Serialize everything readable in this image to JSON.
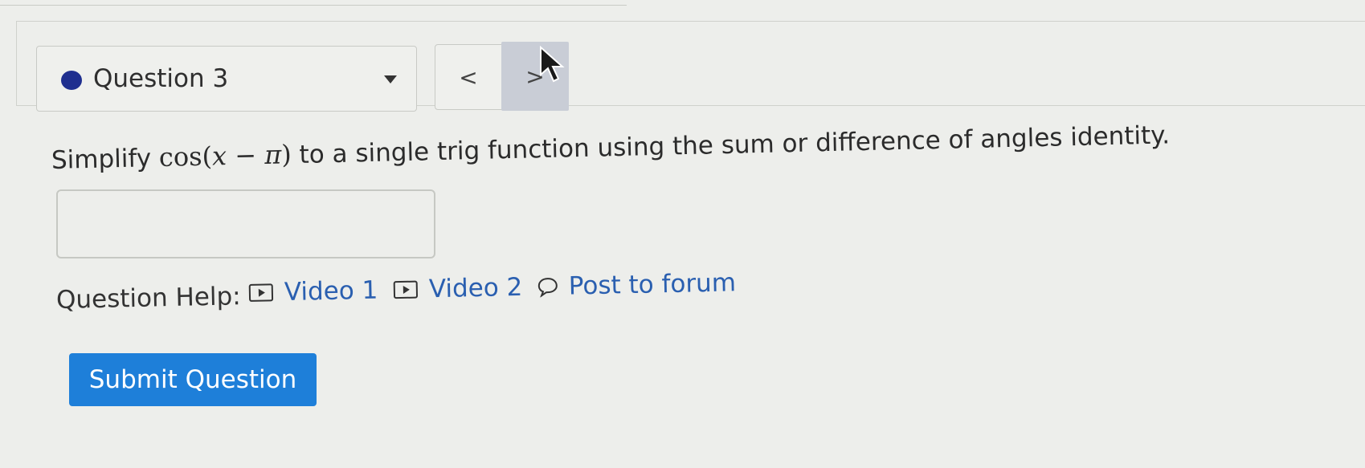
{
  "header": {
    "question_label": "Question 3",
    "status_color": "#1f2f8f",
    "prev_label": "<",
    "next_label": ">",
    "caret_icon": "caret-down-icon"
  },
  "question": {
    "prompt_before": "Simplify",
    "math_func": "cos(",
    "math_var": "x",
    "math_op": " − ",
    "math_const": "π",
    "math_close": ")",
    "prompt_after": "to a single trig function using the sum or difference of angles identity.",
    "answer_value": ""
  },
  "help": {
    "label": "Question Help:",
    "video1": "Video 1",
    "video2": "Video 2",
    "forum": "Post to forum"
  },
  "actions": {
    "submit_label": "Submit Question",
    "submit_color": "#1e7fd9"
  }
}
